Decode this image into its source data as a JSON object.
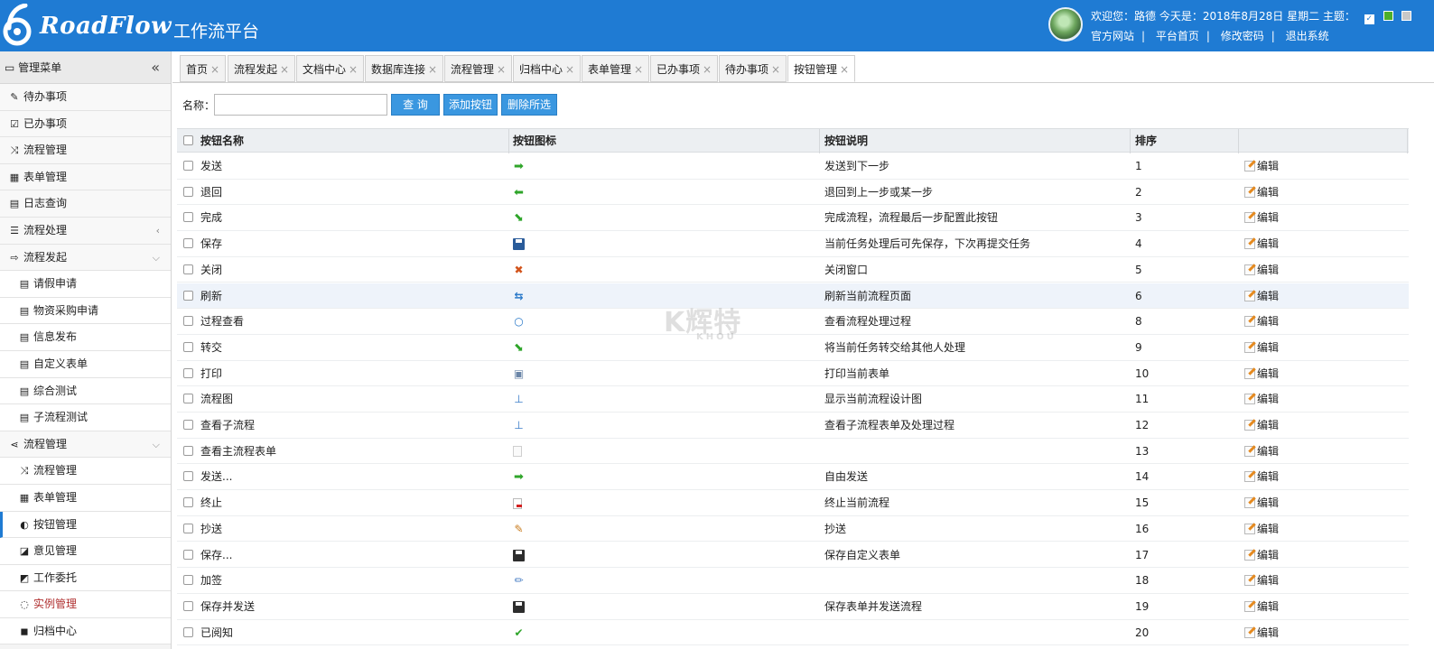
{
  "header": {
    "brand": "RoadFlow",
    "subtitle": "工作流平台",
    "welcome": "欢迎您：路德   今天是：2018年8月28日 星期二   主题：",
    "links": [
      "官方网站",
      "平台首页",
      "修改密码",
      "退出系统"
    ],
    "theme_colors": [
      "#ffffff",
      "#4caf2a",
      "#c8c8c8"
    ],
    "accent": "#1f7bd3"
  },
  "sidebar": {
    "title": "管理菜单",
    "collapse_icon": "«",
    "items": [
      {
        "label": "待办事项",
        "icon": "✎",
        "sub": false
      },
      {
        "label": "已办事项",
        "icon": "☑",
        "sub": false
      },
      {
        "label": "流程管理",
        "icon": "⤨",
        "sub": false
      },
      {
        "label": "表单管理",
        "icon": "▦",
        "sub": false
      },
      {
        "label": "日志查询",
        "icon": "▤",
        "sub": false
      },
      {
        "label": "流程处理",
        "icon": "☰",
        "sub": false,
        "arrow": "‹"
      },
      {
        "label": "流程发起",
        "icon": "⇨",
        "sub": false,
        "arrow": "⌵"
      },
      {
        "label": "请假申请",
        "icon": "▤",
        "sub": true
      },
      {
        "label": "物资采购申请",
        "icon": "▤",
        "sub": true
      },
      {
        "label": "信息发布",
        "icon": "▤",
        "sub": true
      },
      {
        "label": "自定义表单",
        "icon": "▤",
        "sub": true
      },
      {
        "label": "综合测试",
        "icon": "▤",
        "sub": true
      },
      {
        "label": "子流程测试",
        "icon": "▤",
        "sub": true
      },
      {
        "label": "流程管理",
        "icon": "⋖",
        "sub": false,
        "arrow": "⌵"
      },
      {
        "label": "流程管理",
        "icon": "⤨",
        "sub": true
      },
      {
        "label": "表单管理",
        "icon": "▦",
        "sub": true
      },
      {
        "label": "按钮管理",
        "icon": "◐",
        "sub": true,
        "active": true
      },
      {
        "label": "意见管理",
        "icon": "◪",
        "sub": true
      },
      {
        "label": "工作委托",
        "icon": "◩",
        "sub": true
      },
      {
        "label": "实例管理",
        "icon": "◌",
        "sub": true,
        "red": true
      },
      {
        "label": "归档中心",
        "icon": "◼",
        "sub": true
      }
    ]
  },
  "tabs": [
    {
      "label": "首页"
    },
    {
      "label": "流程发起"
    },
    {
      "label": "文档中心"
    },
    {
      "label": "数据库连接"
    },
    {
      "label": "流程管理"
    },
    {
      "label": "归档中心"
    },
    {
      "label": "表单管理"
    },
    {
      "label": "已办事项"
    },
    {
      "label": "待办事项"
    },
    {
      "label": "按钮管理",
      "active": true
    }
  ],
  "toolbar": {
    "name_label": "名称：",
    "name_value": "",
    "query_label": "查 询",
    "add_label": "添加按钮",
    "delete_label": "删除所选"
  },
  "table": {
    "headers": {
      "name": "按钮名称",
      "icon": "按钮图标",
      "desc": "按钮说明",
      "order": "排序",
      "op": ""
    },
    "edit_label": "编辑",
    "rows": [
      {
        "name": "发送",
        "icon": "arrow-right-icon",
        "desc": "发送到下一步",
        "order": "1"
      },
      {
        "name": "退回",
        "icon": "arrow-left-icon",
        "desc": "退回到上一步或某一步",
        "order": "2"
      },
      {
        "name": "完成",
        "icon": "complete-arrow-icon",
        "desc": "完成流程，流程最后一步配置此按钮",
        "order": "3"
      },
      {
        "name": "保存",
        "icon": "save-icon",
        "desc": "当前任务处理后可先保存，下次再提交任务",
        "order": "4"
      },
      {
        "name": "关闭",
        "icon": "close-icon",
        "desc": "关闭窗口",
        "order": "5"
      },
      {
        "name": "刷新",
        "icon": "refresh-icon",
        "desc": "刷新当前流程页面",
        "order": "6",
        "highlight": true
      },
      {
        "name": "过程查看",
        "icon": "search-icon",
        "desc": "查看流程处理过程",
        "order": "8"
      },
      {
        "name": "转交",
        "icon": "complete-arrow-icon",
        "desc": "将当前任务转交给其他人处理",
        "order": "9"
      },
      {
        "name": "打印",
        "icon": "print-icon",
        "desc": "打印当前表单",
        "order": "10"
      },
      {
        "name": "流程图",
        "icon": "flowchart-icon",
        "desc": "显示当前流程设计图",
        "order": "11"
      },
      {
        "name": "查看子流程",
        "icon": "flowchart-icon",
        "desc": "查看子流程表单及处理过程",
        "order": "12"
      },
      {
        "name": "查看主流程表单",
        "icon": "document-icon",
        "desc": "",
        "order": "13"
      },
      {
        "name": "发送...",
        "icon": "arrow-right-icon",
        "desc": "自由发送",
        "order": "14"
      },
      {
        "name": "终止",
        "icon": "stop-document-icon",
        "desc": "终止当前流程",
        "order": "15"
      },
      {
        "name": "抄送",
        "icon": "copy-edit-icon",
        "desc": "抄送",
        "order": "16"
      },
      {
        "name": "保存...",
        "icon": "save-dark-icon",
        "desc": "保存自定义表单",
        "order": "17"
      },
      {
        "name": "加签",
        "icon": "pencil-icon",
        "desc": "",
        "order": "18"
      },
      {
        "name": "保存并发送",
        "icon": "save-dark-icon",
        "desc": "保存表单并发送流程",
        "order": "19"
      },
      {
        "name": "已阅知",
        "icon": "check-icon",
        "desc": "",
        "order": "20"
      }
    ]
  },
  "watermark": {
    "main": "K辉特",
    "sub": "KHOU"
  }
}
